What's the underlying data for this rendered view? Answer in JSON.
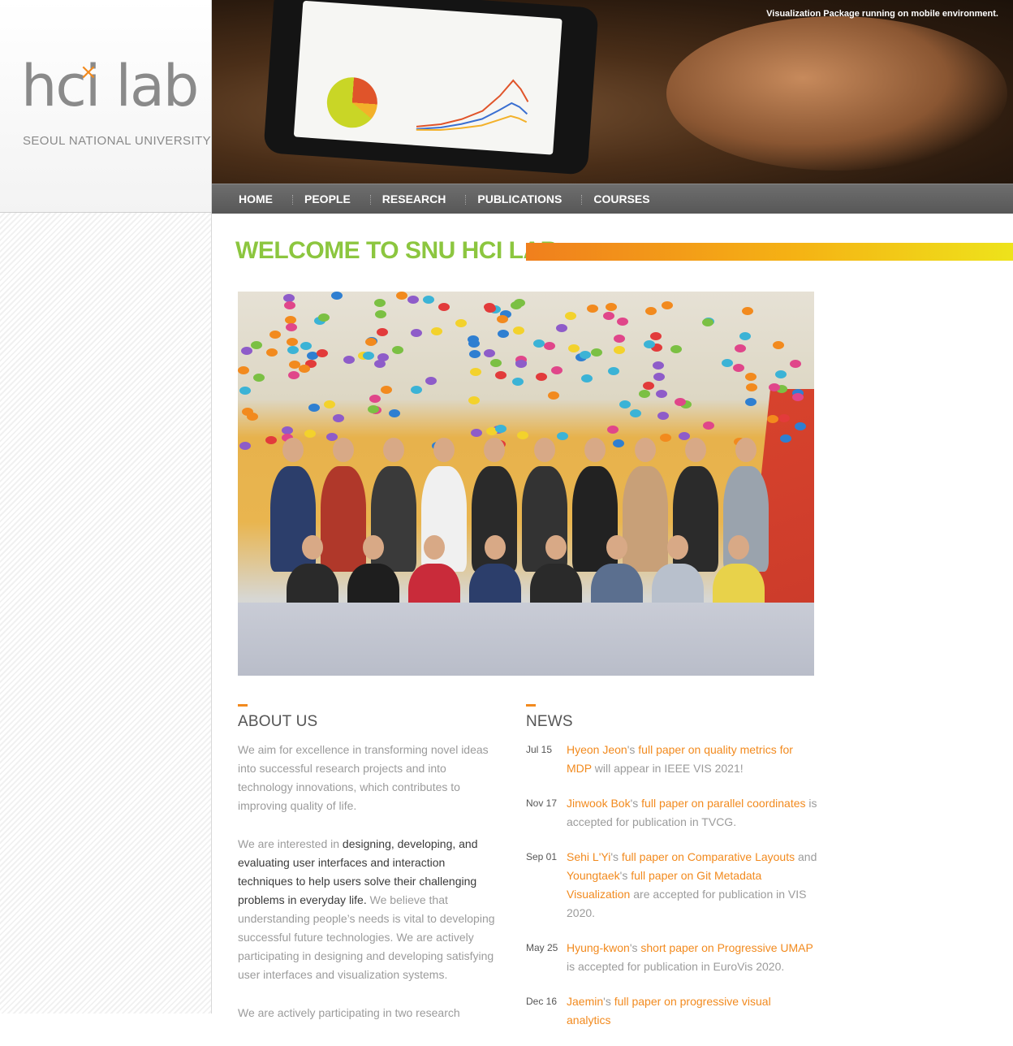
{
  "logo": {
    "word": "hci lab",
    "mark": "×",
    "subtitle": "SEOUL NATIONAL UNIVERSITY"
  },
  "banner": {
    "caption": "Visualization Package running on mobile environment."
  },
  "nav": {
    "items": [
      "HOME",
      "PEOPLE",
      "RESEARCH",
      "PUBLICATIONS",
      "COURSES"
    ]
  },
  "welcome": {
    "title": "WELCOME TO SNU HCI LAB"
  },
  "about": {
    "title": "ABOUT US",
    "p1": "We aim for excellence in transforming novel ideas into successful research projects and into technology innovations, which contributes to improving quality of life.",
    "p2_a": "We are interested in ",
    "p2_b": "designing, developing, and evaluating user interfaces and interaction techniques to help users solve their challenging problems in everyday life.",
    "p2_c": " We believe that understanding people’s needs is vital to developing successful future technologies. We are actively participating in designing and developing satisfying user interfaces and visualization systems.",
    "p3": "We are actively participating in two research"
  },
  "news": {
    "title": "NEWS",
    "items": [
      {
        "date": "Jul 15",
        "parts": [
          {
            "t": "Hyeon Jeon",
            "link": true
          },
          {
            "t": "'s ",
            "link": false
          },
          {
            "t": "full paper on quality metrics for MDP",
            "link": true
          },
          {
            "t": " will appear in IEEE VIS 2021!",
            "link": false
          }
        ]
      },
      {
        "date": "Nov 17",
        "parts": [
          {
            "t": "Jinwook Bok",
            "link": true
          },
          {
            "t": "'s ",
            "link": false
          },
          {
            "t": "full paper on parallel coordinates",
            "link": true
          },
          {
            "t": " is accepted for publication in TVCG.",
            "link": false
          }
        ]
      },
      {
        "date": "Sep 01",
        "parts": [
          {
            "t": "Sehi L'Yi",
            "link": true
          },
          {
            "t": "'s ",
            "link": false
          },
          {
            "t": "full paper on Comparative Layouts",
            "link": true
          },
          {
            "t": " and ",
            "link": false
          },
          {
            "t": "Youngtaek",
            "link": true
          },
          {
            "t": "'s ",
            "link": false
          },
          {
            "t": "full paper on Git Metadata Visualization",
            "link": true
          },
          {
            "t": " are accepted for publication in VIS 2020.",
            "link": false
          }
        ]
      },
      {
        "date": "May 25",
        "parts": [
          {
            "t": "Hyung-kwon",
            "link": true
          },
          {
            "t": "'s ",
            "link": false
          },
          {
            "t": "short paper on Progressive UMAP",
            "link": true
          },
          {
            "t": " is accepted for publication in EuroVis 2020.",
            "link": false
          }
        ]
      },
      {
        "date": "Dec 16",
        "parts": [
          {
            "t": "Jaemin",
            "link": true
          },
          {
            "t": "'s ",
            "link": false
          },
          {
            "t": "full paper on progressive visual analytics",
            "link": true
          }
        ]
      }
    ]
  },
  "colors": {
    "accent_orange": "#f28a1e",
    "welcome_green": "#8cc63f",
    "nav_gray": "#5f5f5f"
  }
}
